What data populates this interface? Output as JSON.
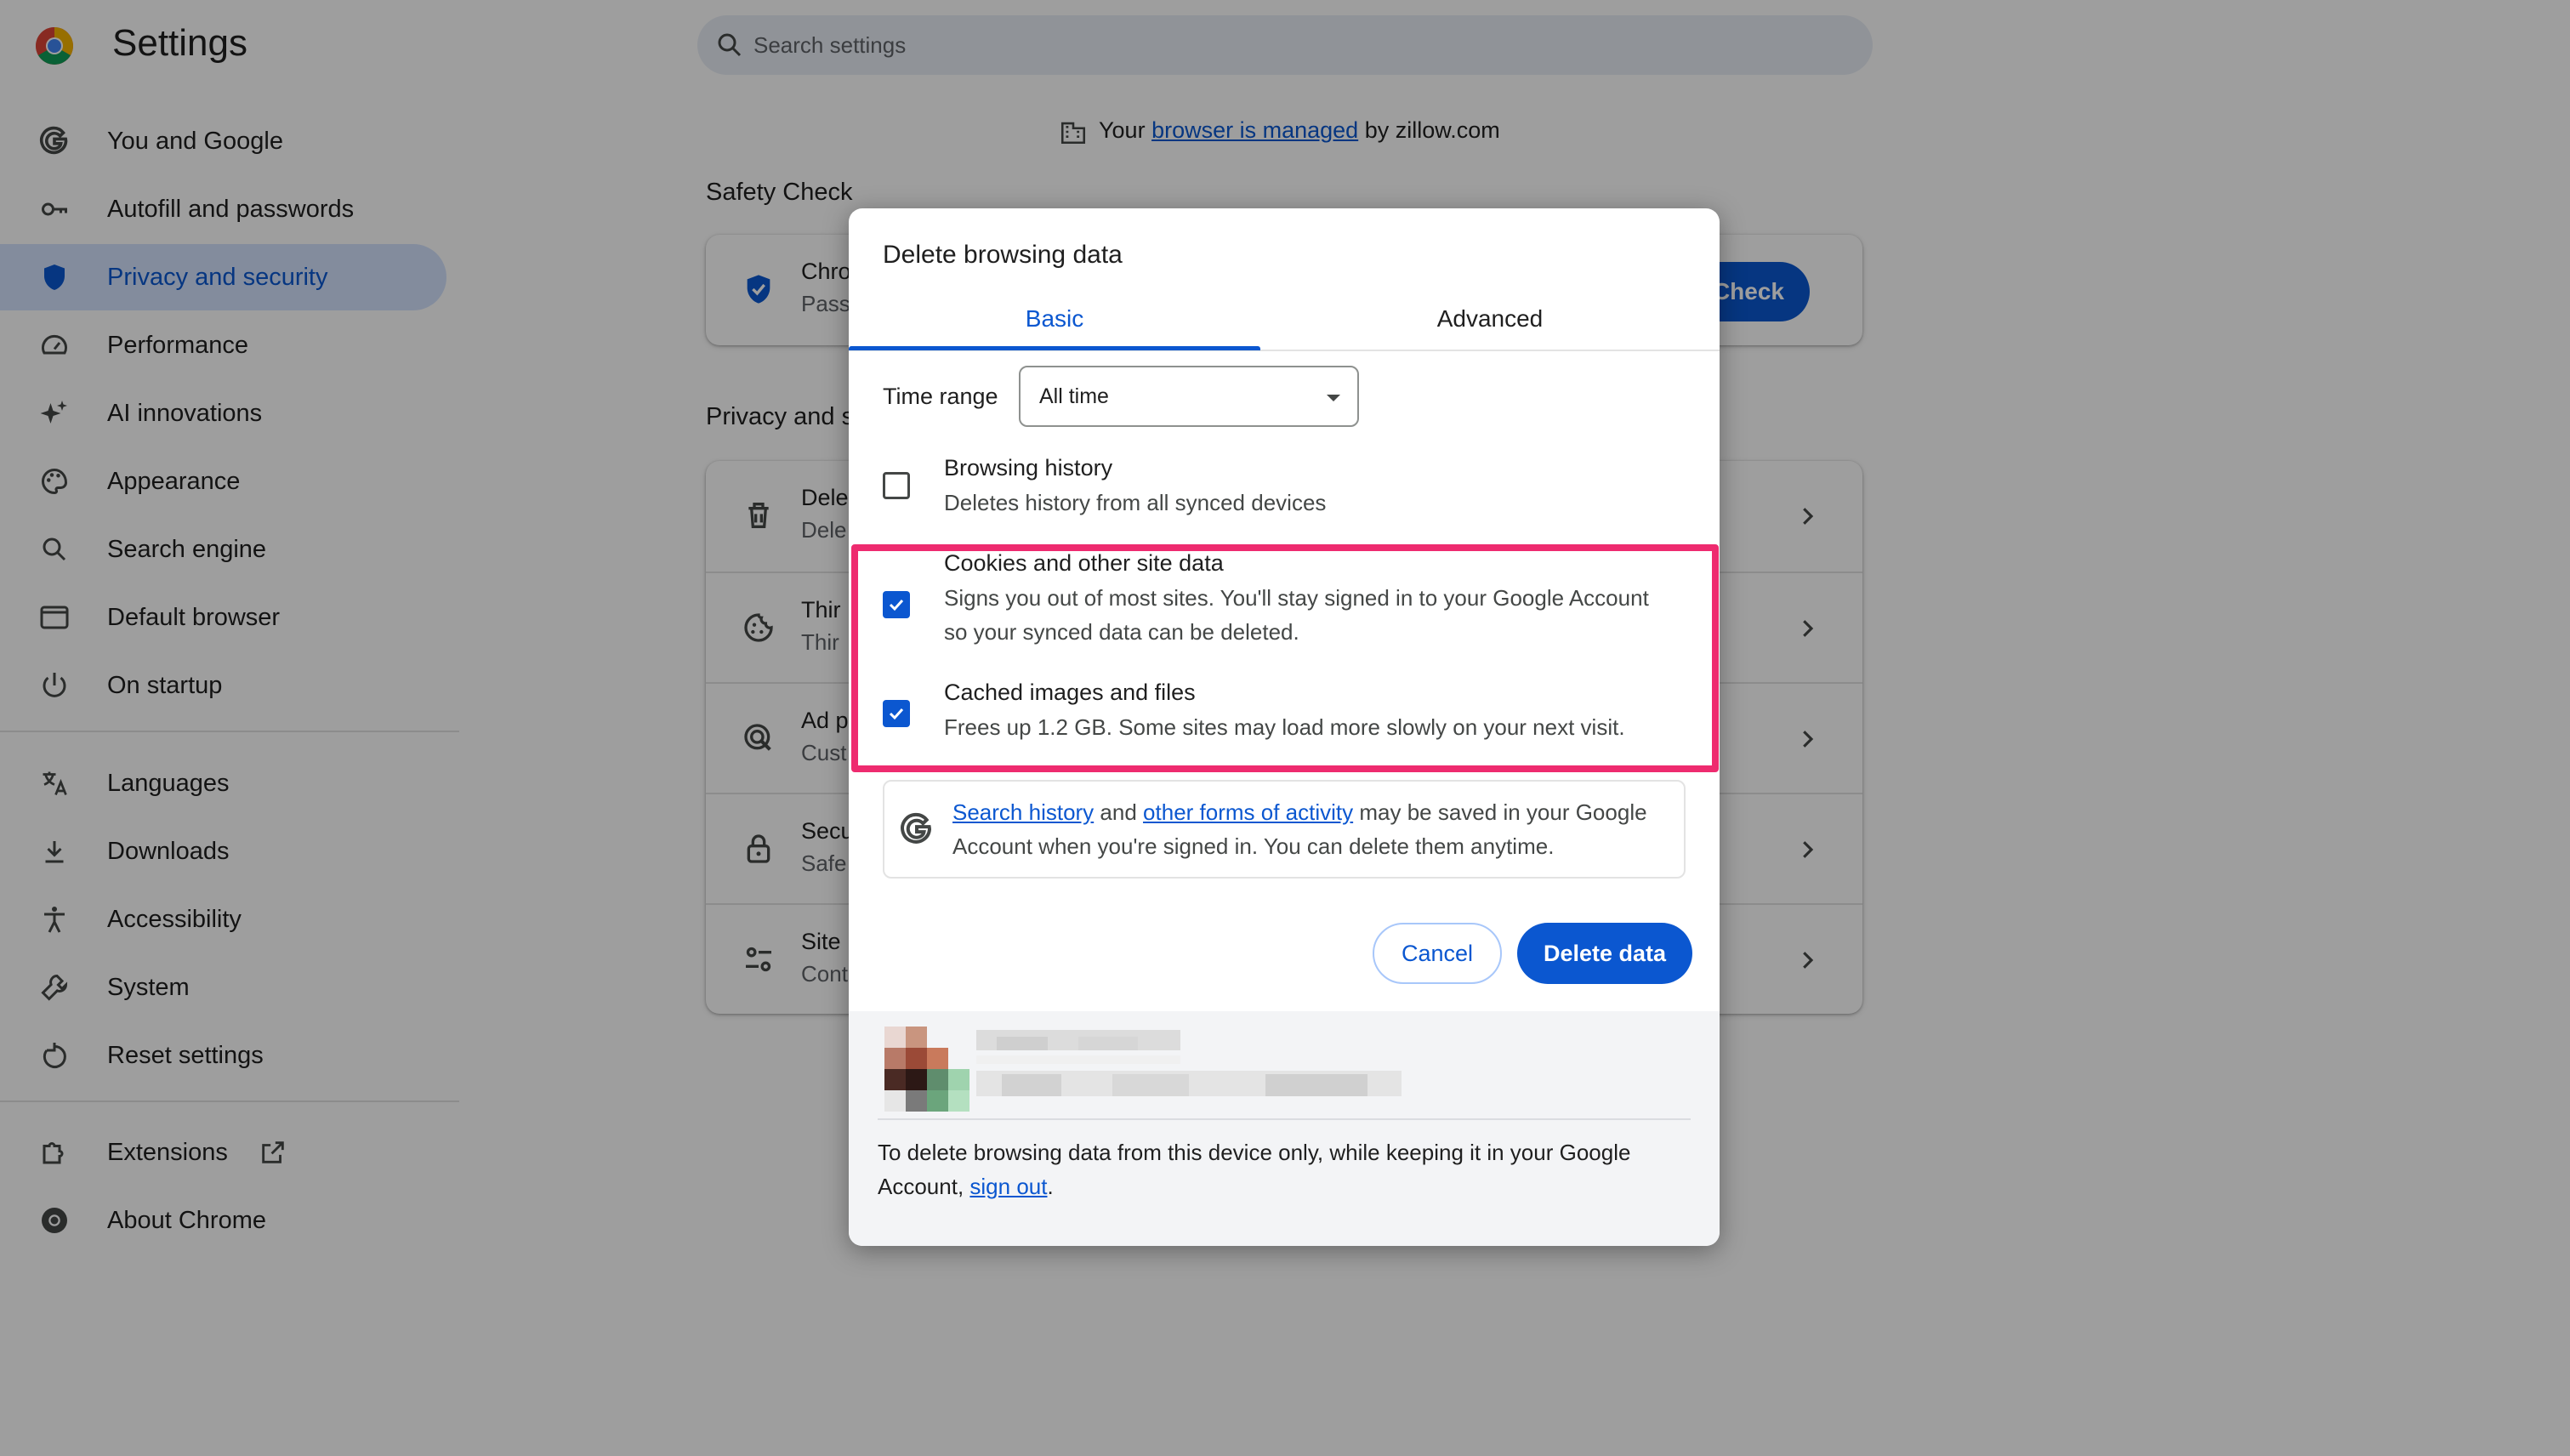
{
  "app": {
    "title": "Settings"
  },
  "search": {
    "placeholder": "Search settings"
  },
  "sidebar": {
    "items": [
      {
        "label": "You and Google",
        "icon": "google-g-icon",
        "active": false
      },
      {
        "label": "Autofill and passwords",
        "icon": "key-icon",
        "active": false
      },
      {
        "label": "Privacy and security",
        "icon": "shield-icon",
        "active": true
      },
      {
        "label": "Performance",
        "icon": "speedometer-icon",
        "active": false
      },
      {
        "label": "AI innovations",
        "icon": "sparkle-icon",
        "active": false
      },
      {
        "label": "Appearance",
        "icon": "palette-icon",
        "active": false
      },
      {
        "label": "Search engine",
        "icon": "search-icon",
        "active": false
      },
      {
        "label": "Default browser",
        "icon": "browser-window-icon",
        "active": false
      },
      {
        "label": "On startup",
        "icon": "power-icon",
        "active": false
      },
      {
        "label": "Languages",
        "icon": "translate-icon",
        "active": false
      },
      {
        "label": "Downloads",
        "icon": "download-icon",
        "active": false
      },
      {
        "label": "Accessibility",
        "icon": "accessibility-icon",
        "active": false
      },
      {
        "label": "System",
        "icon": "wrench-icon",
        "active": false
      },
      {
        "label": "Reset settings",
        "icon": "reset-icon",
        "active": false
      },
      {
        "label": "Extensions",
        "icon": "puzzle-icon",
        "active": false
      },
      {
        "label": "About Chrome",
        "icon": "chrome-icon",
        "active": false
      }
    ]
  },
  "managed": {
    "prefix": "Your",
    "link": "browser is managed",
    "suffix": "by zillow.com"
  },
  "safety_check": {
    "heading": "Safety Check",
    "row_title": "Chro",
    "row_sub": "Passw",
    "button": "y Check"
  },
  "privacy": {
    "heading": "Privacy and s",
    "rows": [
      {
        "t1": "Dele",
        "t2": "Dele",
        "icon": "trash-icon"
      },
      {
        "t1": "Thir",
        "t2": "Thir",
        "icon": "cookie-icon"
      },
      {
        "t1": "Ad p",
        "t2": "Cust",
        "icon": "ad-privacy-icon"
      },
      {
        "t1": "Secu",
        "t2": "Safe",
        "icon": "lock-icon"
      },
      {
        "t1": "Site",
        "t2": "Cont",
        "icon": "tune-icon"
      }
    ]
  },
  "dialog": {
    "title": "Delete browsing data",
    "tabs": {
      "basic": "Basic",
      "advanced": "Advanced",
      "selected": "Basic"
    },
    "time_range": {
      "label": "Time range",
      "value": "All time"
    },
    "options": [
      {
        "title": "Browsing history",
        "desc": "Deletes history from all synced devices",
        "checked": false
      },
      {
        "title": "Cookies and other site data",
        "desc": "Signs you out of most sites. You'll stay signed in to your Google Account so your synced data can be deleted.",
        "checked": true
      },
      {
        "title": "Cached images and files",
        "desc": "Frees up 1.2 GB. Some sites may load more slowly on your next visit.",
        "checked": true
      }
    ],
    "google_notice": {
      "link1": "Search history",
      "mid": "and",
      "link2": "other forms of activity",
      "rest": "may be saved in your Google Account when you're signed in. You can delete them anytime."
    },
    "buttons": {
      "cancel": "Cancel",
      "delete": "Delete data"
    },
    "footer": {
      "text": "To delete browsing data from this device only, while keeping it in your Google Account,",
      "link": "sign out",
      "end": "."
    },
    "highlight_color": "#ee2b6f"
  },
  "colors": {
    "accent": "#0b57d0",
    "active_nav": "#d3e3fd",
    "highlight": "#ee2b6f"
  }
}
